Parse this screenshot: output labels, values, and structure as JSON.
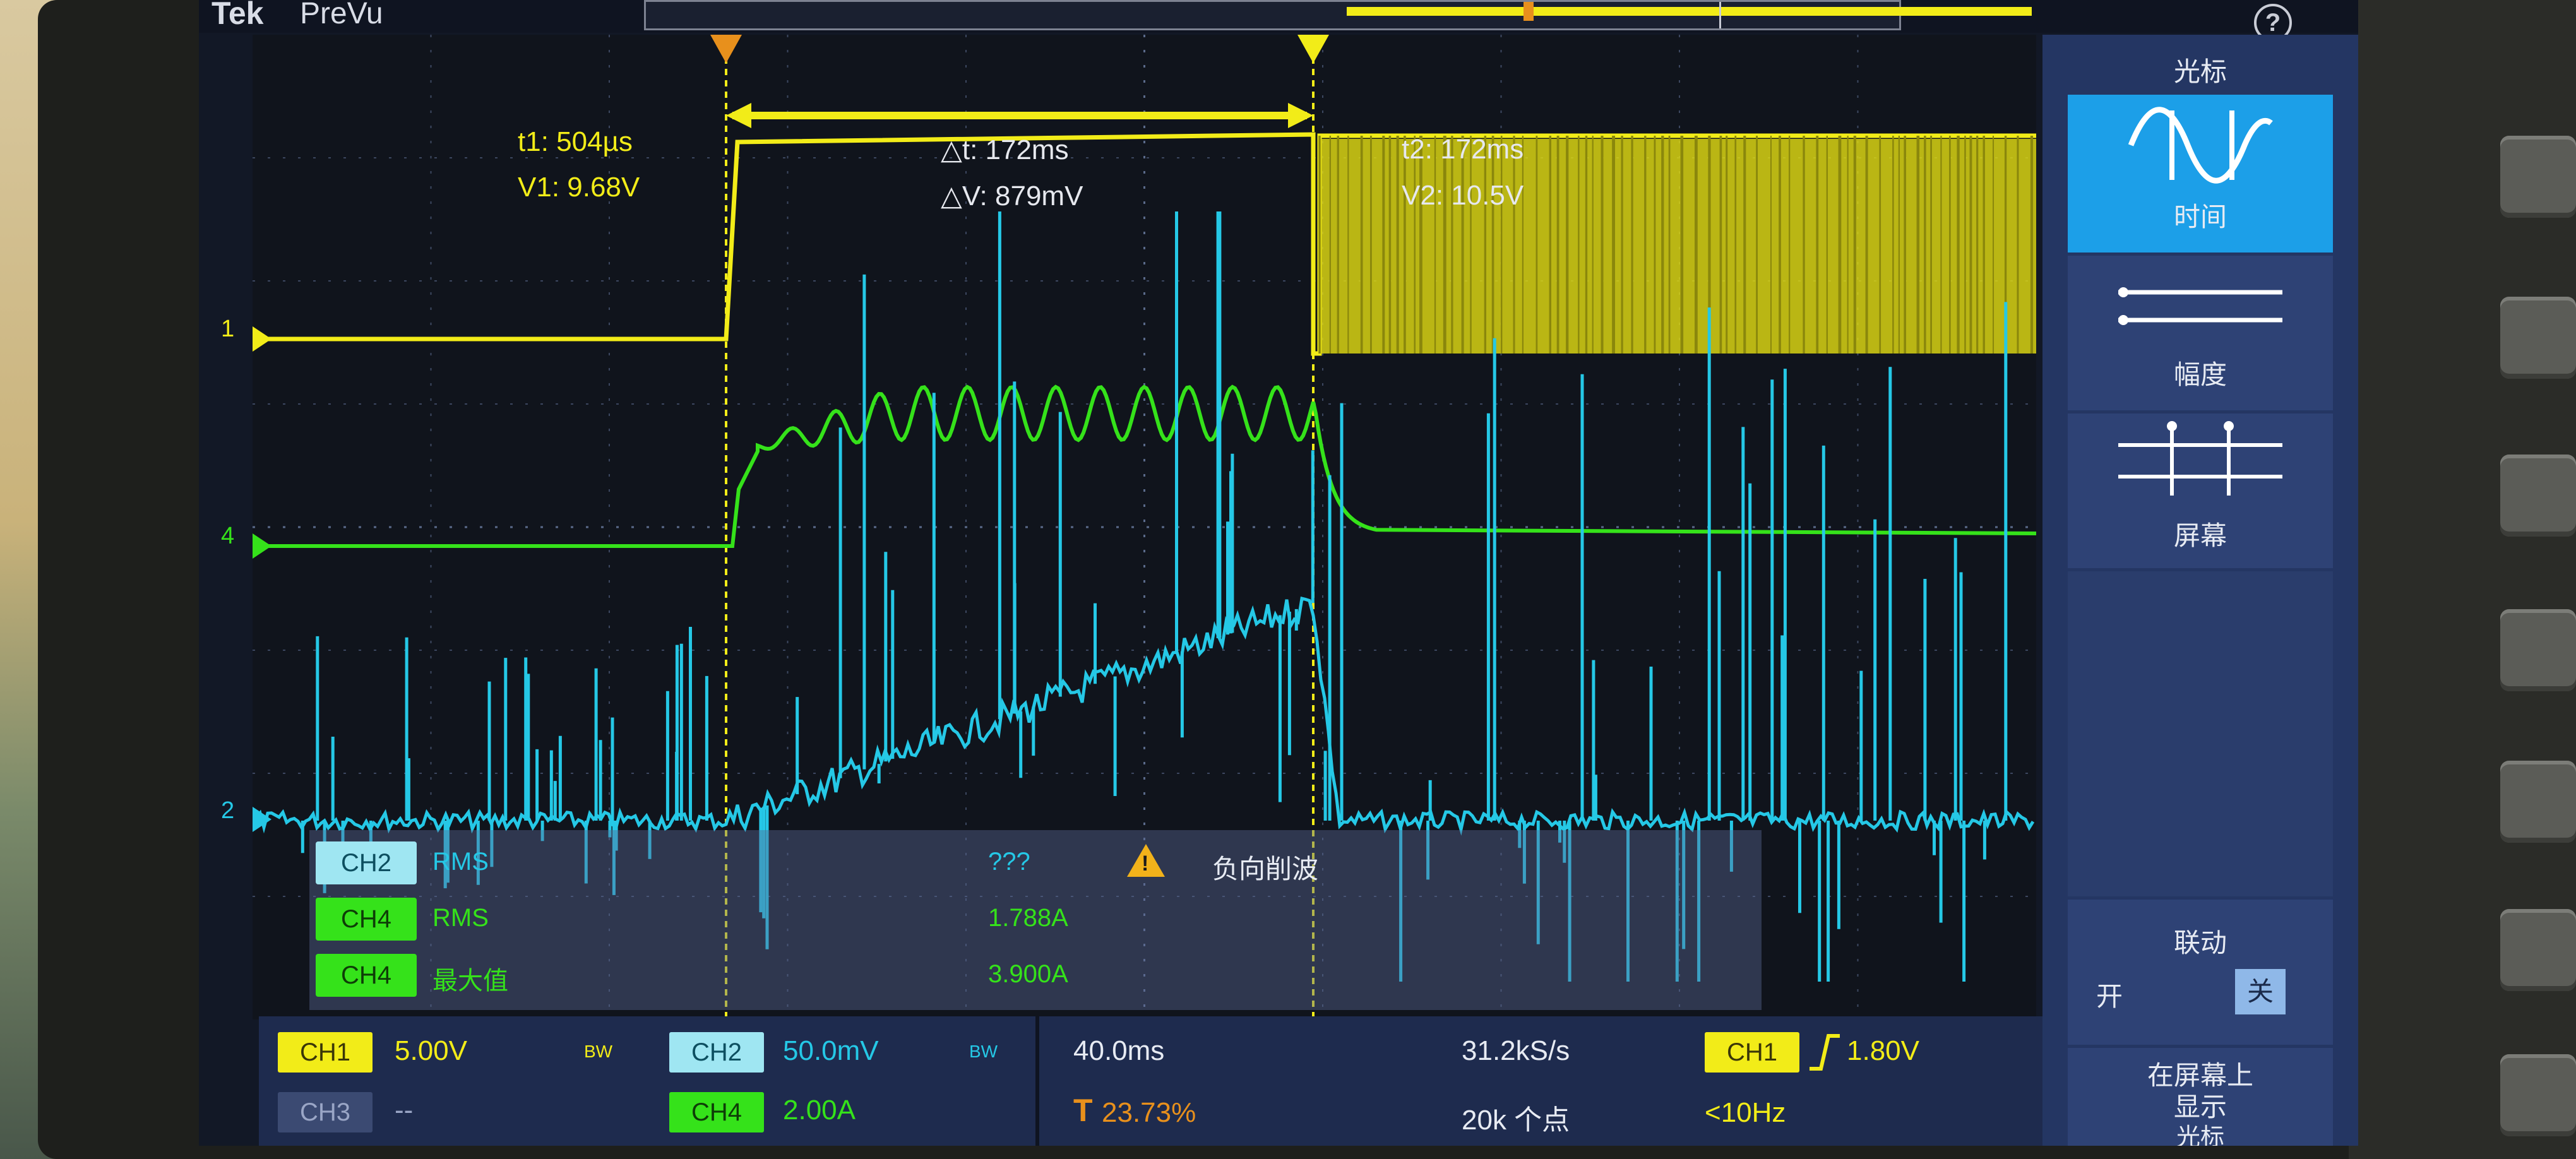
{
  "topbar": {
    "brand": "Tek",
    "mode": "PreVu",
    "help_icon": "help-icon"
  },
  "cursors": {
    "t1": "t1: 504µs",
    "v1": "V1: 9.68V",
    "dt": "△t: 172ms",
    "dv": "△V: 879mV",
    "t2": "t2: 172ms",
    "v2": "V2: 10.5V"
  },
  "channel_markers": {
    "ch1": "1",
    "ch2": "2",
    "ch4": "4"
  },
  "measurements": {
    "rows": [
      {
        "badge": "CH2",
        "name": "RMS",
        "value": "???"
      },
      {
        "badge": "CH4",
        "name": "RMS",
        "value": "1.788A"
      },
      {
        "badge": "CH4",
        "name": "最大值",
        "value": "3.900A"
      }
    ],
    "warning": "负向削波",
    "warning_icon": "warning-icon"
  },
  "status": {
    "ch1": {
      "label": "CH1",
      "scale": "5.00V",
      "bw": "BW"
    },
    "ch2": {
      "label": "CH2",
      "scale": "50.0mV",
      "bw": "BW"
    },
    "ch3": {
      "label": "CH3",
      "scale": "--"
    },
    "ch4": {
      "label": "CH4",
      "scale": "2.00A"
    },
    "timebase": "40.0ms",
    "trigger_pos_icon": "T",
    "trigger_pos": "23.73%",
    "sample_rate": "31.2kS/s",
    "record_length": "20k 个点",
    "trig_source": "CH1",
    "trig_level": "1.80V",
    "trig_freq": "<10Hz"
  },
  "menu": {
    "title": "光标",
    "items": [
      {
        "label": "时间",
        "icon": "time-cursor-icon"
      },
      {
        "label": "幅度",
        "icon": "amplitude-cursor-icon"
      },
      {
        "label": "屏幕",
        "icon": "screen-cursor-icon"
      }
    ],
    "link_label": "联动",
    "link_on": "开",
    "link_off": "关",
    "show_line1": "在屏幕上",
    "show_line2": "显示",
    "show_line3": "光标"
  },
  "colors": {
    "ch1": "#f2ec18",
    "ch2": "#25c8e6",
    "ch4": "#35e21a",
    "menu_selected": "#1c9fe8"
  }
}
